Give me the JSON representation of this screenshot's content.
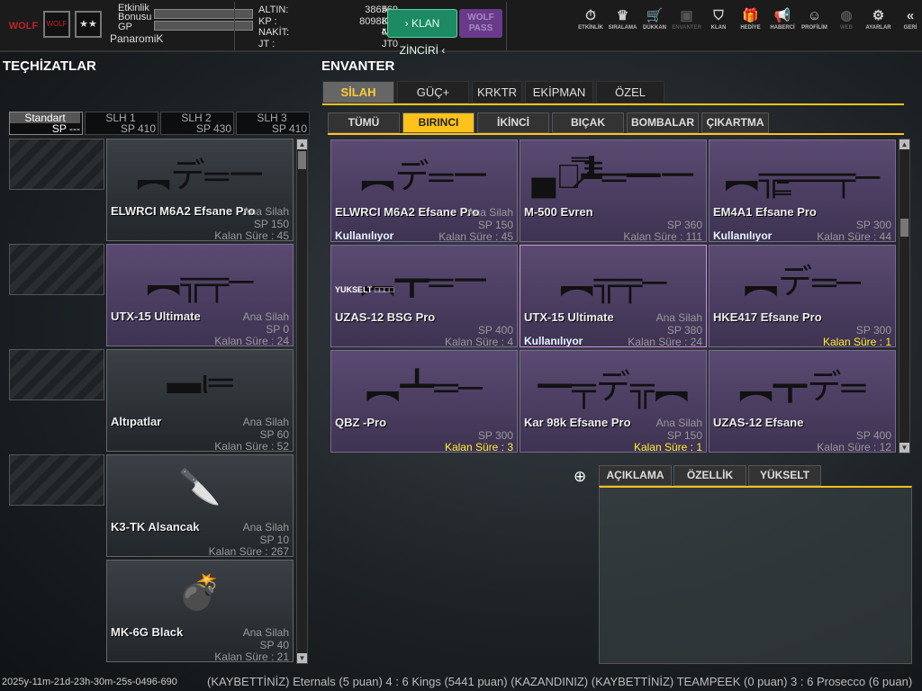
{
  "topbar": {
    "logo": "WOLF",
    "badge_rank": "WOLF",
    "badge_stars": "★★",
    "event_bonus_label": "Etkinlik Bonusu",
    "gp_label": "GP",
    "username": "PanaromiK",
    "currencies": [
      {
        "label": "ALTIN:",
        "value": "386569",
        "unit": "A"
      },
      {
        "label": "KP :",
        "value": "8098881",
        "unit": "KP"
      },
      {
        "label": "NAKİT:",
        "value": "456",
        "unit": "N"
      },
      {
        "label": "JT :",
        "value": "0",
        "unit": "JT"
      }
    ],
    "klan_zinciri": "› KLAN ZİNCİRİ ‹",
    "wolf_pass": "WOLF PASS",
    "nav": [
      {
        "label": "ETKİNLİK",
        "icon": "⏱"
      },
      {
        "label": "SIRALAMA",
        "icon": "♛"
      },
      {
        "label": "DÜKKAN",
        "icon": "🛒"
      },
      {
        "label": "ENVANTER",
        "icon": "▣"
      },
      {
        "label": "KLAN",
        "icon": "⛉"
      },
      {
        "label": "HEDİYE",
        "icon": "🎁"
      },
      {
        "label": "HABERCİ",
        "icon": "📢"
      },
      {
        "label": "PROFİLİM",
        "icon": "☺"
      },
      {
        "label": "WEB",
        "icon": "◍"
      },
      {
        "label": "AYARLAR",
        "icon": "⚙"
      },
      {
        "label": "GERİ",
        "icon": "«"
      }
    ]
  },
  "left": {
    "title": "TEÇHİZATLAR",
    "loadouts": [
      {
        "name": "Standart",
        "sp": "SP ---"
      },
      {
        "name": "SLH 1",
        "sp": "SP 410"
      },
      {
        "name": "SLH 2",
        "sp": "SP 430"
      },
      {
        "name": "SLH 3",
        "sp": "SP 410"
      }
    ],
    "items": [
      {
        "name": "ELWRCI M6A2 Efsane Pro",
        "type": "Ana Silah",
        "sp": "SP 150",
        "remaining": "Kalan Süre : 45",
        "icon": "︻デ═一",
        "purple": false
      },
      {
        "name": "UTX-15 Ultimate",
        "type": "Ana Silah",
        "sp": "SP 0",
        "remaining": "Kalan Süre : 24",
        "icon": "︻╦╤─",
        "purple": true
      },
      {
        "name": "Altıpatlar",
        "type": "Ana Silah",
        "sp": "SP 60",
        "remaining": "Kalan Süre : 52",
        "icon": "▬ι═",
        "purple": false
      },
      {
        "name": "K3-TK Alsancak",
        "type": "Ana Silah",
        "sp": "SP 10",
        "remaining": "Kalan Süre : 267",
        "icon": "🔪",
        "purple": false
      },
      {
        "name": "MK-6G Black",
        "type": "Ana Silah",
        "sp": "SP 40",
        "remaining": "Kalan Süre : 21",
        "icon": "💣",
        "purple": false
      }
    ]
  },
  "inventory": {
    "title": "ENVANTER",
    "tabs": [
      "SİLAH",
      "GÜÇ+",
      "KRKTR",
      "EKİPMAN",
      "ÖZEL"
    ],
    "subtabs": [
      "TÜMÜ",
      "BIRINCI",
      "İKİNCİ",
      "BIÇAK",
      "BOMBALAR",
      "ÇIKARTMA"
    ],
    "items": [
      {
        "name": "ELWRCI M6A2 Efsane Pro",
        "type": "Ana Silah",
        "sp": "SP 150",
        "remaining": "Kalan Süre : 45",
        "status": "Kullanılıyor",
        "icon": "︻デ═一",
        "warn": false
      },
      {
        "name": "M-500 Evren",
        "type": "",
        "sp": "SP 360",
        "remaining": "Kalan Süre : 111",
        "status": "",
        "icon": "▄︻̷̿┻̿═━一",
        "warn": false
      },
      {
        "name": "EM4A1 Efsane Pro",
        "type": "",
        "sp": "SP 300",
        "remaining": "Kalan Süre : 44",
        "status": "Kullanılıyor",
        "icon": "︻╦̵̵͇══╤─",
        "warn": false
      },
      {
        "name": "UZAS-12 BSG Pro",
        "type": "",
        "sp": "SP 400",
        "remaining": "Kalan Süre : 4",
        "status": "",
        "icon": "︻┳═一",
        "warn": false,
        "upgrade": "YUKSELT □□□□"
      },
      {
        "name": "UTX-15 Ultimate",
        "type": "Ana Silah",
        "sp": "SP 380",
        "remaining": "Kalan Süre : 24",
        "status": "Kullanılıyor",
        "icon": "︻╦╤─",
        "warn": false,
        "selected": true
      },
      {
        "name": "HKE417 Efsane Pro",
        "type": "",
        "sp": "SP 300",
        "remaining": "Kalan Süre : 1",
        "status": "",
        "icon": "︻デ═─",
        "warn": true
      },
      {
        "name": "QBZ -Pro",
        "type": "",
        "sp": "SP 300",
        "remaining": "Kalan Süre : 3",
        "status": "",
        "icon": "︻┻═─",
        "warn": true
      },
      {
        "name": "Kar 98k Efsane Pro",
        "type": "Ana Silah",
        "sp": "SP 150",
        "remaining": "Kalan Süre : 1",
        "status": "",
        "icon": "━╤デ╦︻",
        "warn": true
      },
      {
        "name": "UZAS-12 Efsane",
        "type": "",
        "sp": "SP 400",
        "remaining": "Kalan Süre : 12",
        "status": "",
        "icon": "︻┳デ═",
        "warn": false
      }
    ],
    "detail_tabs": [
      "AÇIKLAMA",
      "ÖZELLİK",
      "YÜKSELT"
    ]
  },
  "ticker": "(KAYBETTİNİZ) Eternals (5 puan) 4 : 6 Kings (5441 puan) (KAZANDINIZ)        (KAYBETTİNİZ) TEAMPEEK (0 puan) 3 : 6 Prosecco (6 puan)",
  "timestamp": "2025y-11m-21d-23h-30m-25s-0496-690"
}
